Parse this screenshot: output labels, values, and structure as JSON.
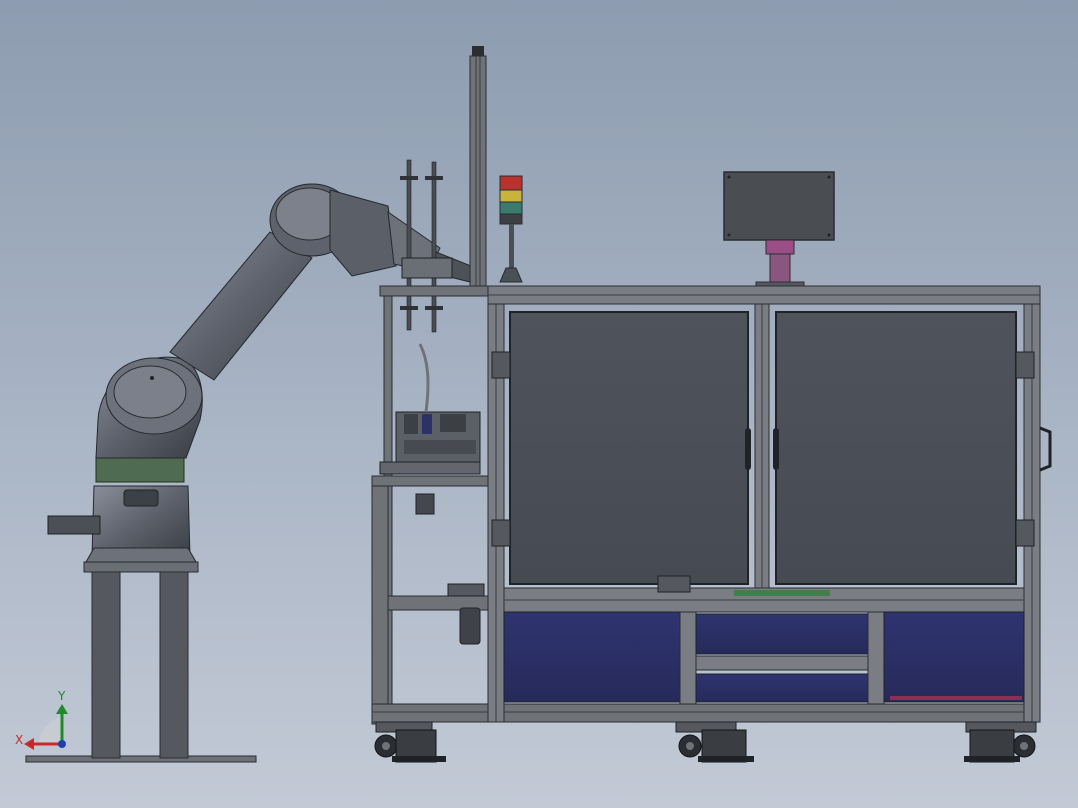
{
  "triad": {
    "x_label": "X",
    "y_label": "Y"
  },
  "colors": {
    "background_top": "#8d9cb0",
    "background_bottom": "#c3cad6",
    "frame_profile": "#6f7378",
    "frame_edge": "#2a2d31",
    "door_panel": "#4b4f57",
    "drawer_panel": "#2d3266",
    "robot_body": "#5a5f68",
    "robot_band": "#4f6b52",
    "screen": "#4a4d52",
    "screen_mount": "#9b4d88",
    "tower_red": "#b8322e",
    "tower_yellow": "#c8b43a",
    "tower_green": "#3a7b6e"
  },
  "icons": {
    "robot": "industrial-robot-arm",
    "cabinet": "machine-cabinet",
    "signal_tower": "stack-light",
    "triad": "coordinate-axes"
  }
}
